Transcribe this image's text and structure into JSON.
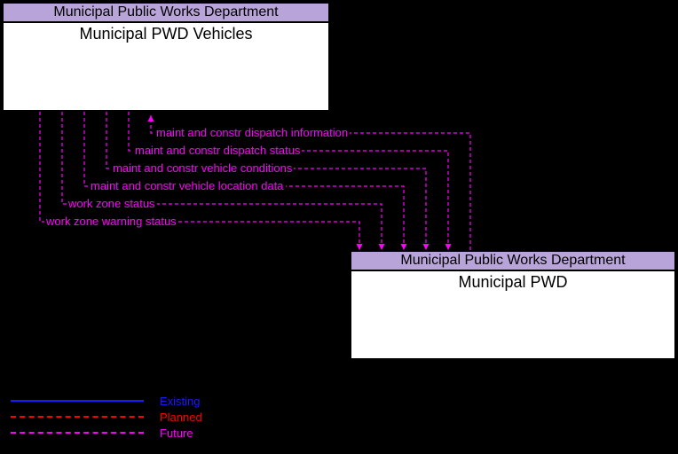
{
  "entities": {
    "top": {
      "header": "Municipal Public Works Department",
      "body": "Municipal PWD Vehicles"
    },
    "bottom": {
      "header": "Municipal Public Works Department",
      "body": "Municipal PWD"
    }
  },
  "flows": [
    {
      "label": "maint and constr dispatch information"
    },
    {
      "label": "maint and constr dispatch status"
    },
    {
      "label": "maint and constr vehicle conditions"
    },
    {
      "label": "maint and constr vehicle location data"
    },
    {
      "label": "work zone status"
    },
    {
      "label": "work zone warning status"
    }
  ],
  "legend": {
    "existing": "Existing",
    "planned": "Planned",
    "future": "Future"
  },
  "chart_data": {
    "type": "diagram",
    "title": "Architecture Flow Diagram",
    "nodes": [
      {
        "id": "municipal-pwd-vehicles",
        "group": "Municipal Public Works Department",
        "label": "Municipal PWD Vehicles"
      },
      {
        "id": "municipal-pwd",
        "group": "Municipal Public Works Department",
        "label": "Municipal PWD"
      }
    ],
    "edges": [
      {
        "from": "municipal-pwd",
        "to": "municipal-pwd-vehicles",
        "label": "maint and constr dispatch information",
        "status": "Future"
      },
      {
        "from": "municipal-pwd-vehicles",
        "to": "municipal-pwd",
        "label": "maint and constr dispatch status",
        "status": "Future"
      },
      {
        "from": "municipal-pwd-vehicles",
        "to": "municipal-pwd",
        "label": "maint and constr vehicle conditions",
        "status": "Future"
      },
      {
        "from": "municipal-pwd-vehicles",
        "to": "municipal-pwd",
        "label": "maint and constr vehicle location data",
        "status": "Future"
      },
      {
        "from": "municipal-pwd-vehicles",
        "to": "municipal-pwd",
        "label": "work zone status",
        "status": "Future"
      },
      {
        "from": "municipal-pwd-vehicles",
        "to": "municipal-pwd",
        "label": "work zone warning status",
        "status": "Future"
      }
    ],
    "legend": [
      "Existing",
      "Planned",
      "Future"
    ]
  }
}
